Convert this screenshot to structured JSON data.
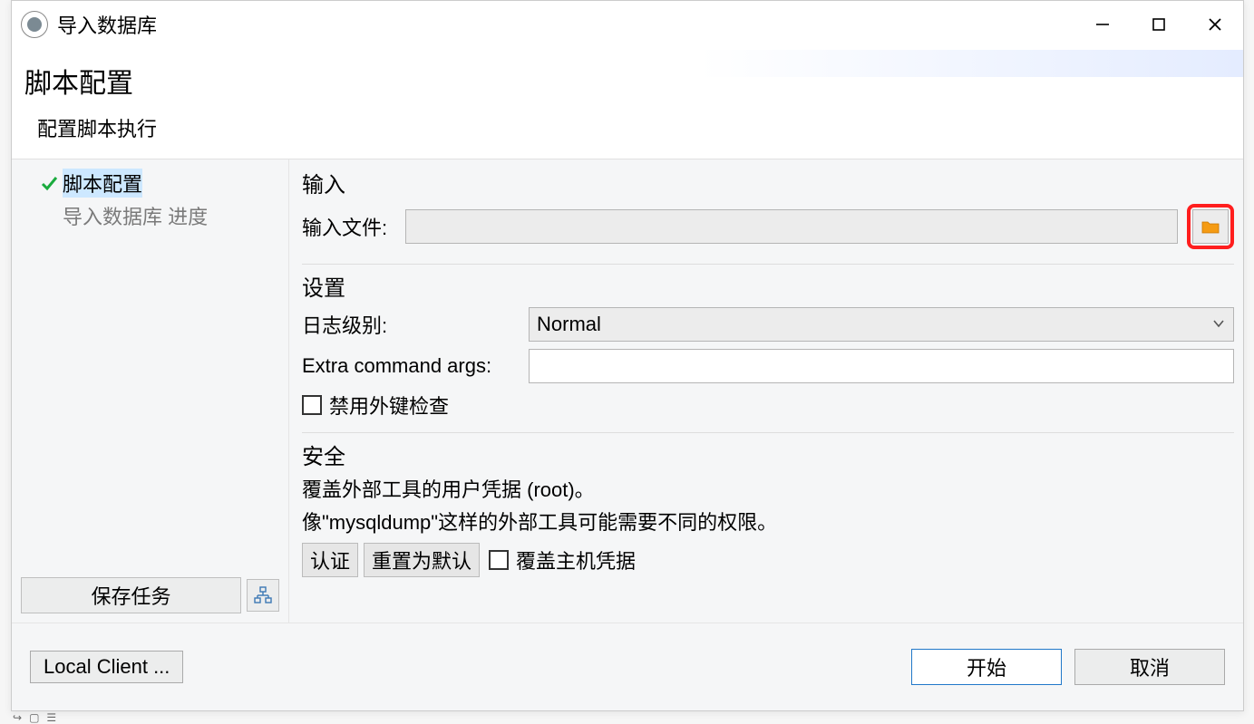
{
  "window": {
    "title": "导入数据库"
  },
  "header": {
    "title": "脚本配置",
    "subtitle": "配置脚本执行"
  },
  "sidebar": {
    "steps": [
      {
        "label": "脚本配置",
        "checked": true,
        "selected": true
      },
      {
        "label": "导入数据库 进度",
        "checked": false,
        "selected": false
      }
    ],
    "save_task_label": "保存任务"
  },
  "groups": {
    "input": {
      "title": "输入",
      "input_file_label": "输入文件:",
      "input_file_value": ""
    },
    "settings": {
      "title": "设置",
      "log_level_label": "日志级别:",
      "log_level_value": "Normal",
      "extra_args_label": "Extra command args:",
      "extra_args_value": "",
      "disable_fk_label": "禁用外键检查"
    },
    "security": {
      "title": "安全",
      "line1": "覆盖外部工具的用户凭据 (root)。",
      "line2": "像\"mysqldump\"这样的外部工具可能需要不同的权限。",
      "auth_btn": "认证",
      "reset_btn": "重置为默认",
      "override_host_label": "覆盖主机凭据"
    }
  },
  "footer": {
    "local_client_label": "Local Client ...",
    "start_label": "开始",
    "cancel_label": "取消"
  }
}
